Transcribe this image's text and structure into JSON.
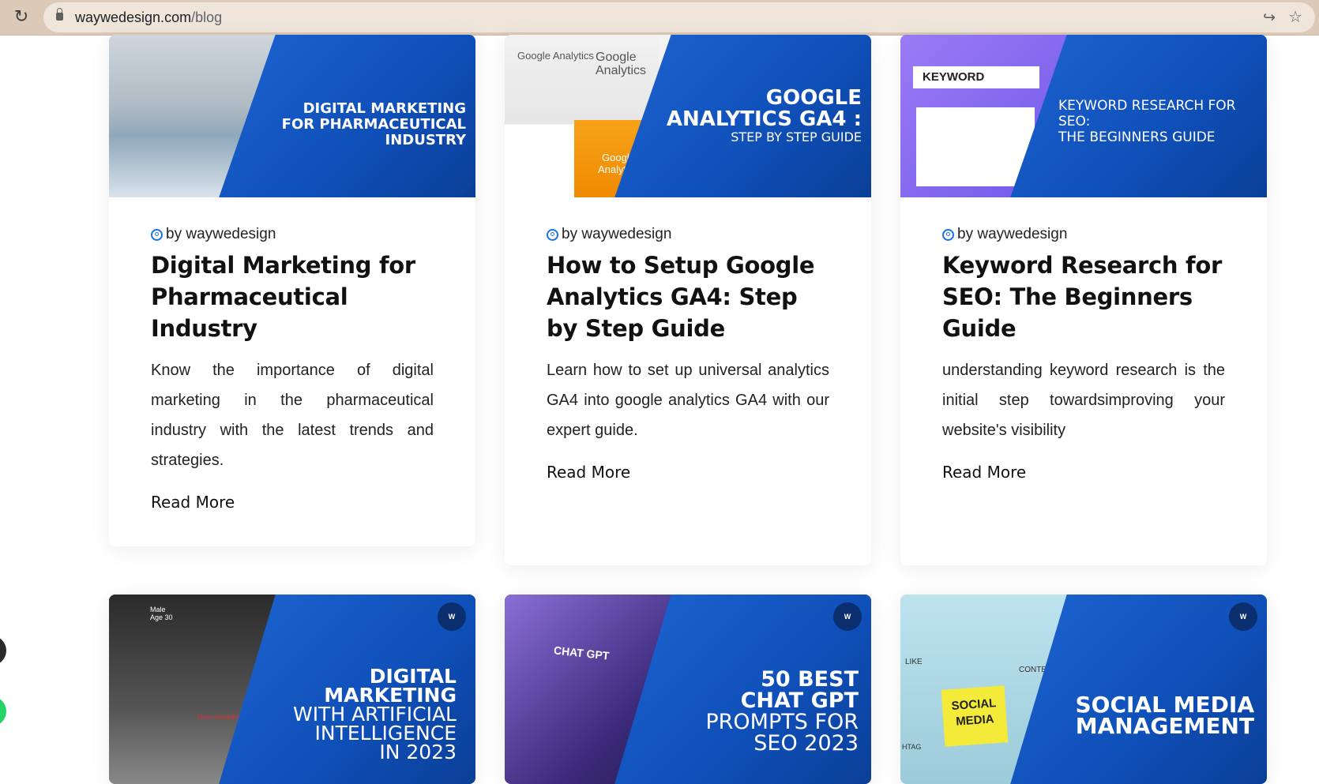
{
  "browser": {
    "url_host": "waywedesign.com",
    "url_path": "/blog"
  },
  "posts": [
    {
      "image_title": "DIGITAL MARKETING FOR PHARMACEUTICAL INDUSTRY",
      "image_lines": [
        "DIGITAL MARKETING",
        "FOR PHARMACEUTICAL",
        "INDUSTRY"
      ],
      "author": "by waywedesign",
      "title": "Digital Marketing for Pharmaceutical Industry",
      "excerpt": "Know the importance of digital marketing in the pharmaceutical industry with the latest trends and strategies.",
      "read_more": "Read More"
    },
    {
      "image_lines": [
        "GOOGLE",
        "ANALYTICS GA4 :",
        "STEP BY STEP GUIDE"
      ],
      "image_labels": [
        "Google Analytics",
        "Google Analytics",
        "Google Analytics"
      ],
      "author": "by waywedesign",
      "title": "How to Setup Google Analytics GA4: Step by Step Guide",
      "excerpt": "Learn how to set up universal analytics GA4 into google analytics GA4 with our expert guide.",
      "read_more": "Read More"
    },
    {
      "image_lines": [
        "KEYWORD RESEARCH FOR SEO:",
        "THE BEGINNERS GUIDE"
      ],
      "image_label": "KEYWORD",
      "author": "by waywedesign",
      "title": "Keyword Research for SEO: The Beginners Guide",
      "excerpt": "understanding keyword research is the initial step towardsimproving your website's visibility",
      "read_more": "Read More"
    }
  ],
  "next_row": [
    {
      "image_lines": [
        "DIGITAL",
        "MARKETING",
        "WITH ARTIFICIAL",
        "INTELLIGENCE",
        "IN 2023"
      ],
      "photo_labels": [
        "Male",
        "Age 30",
        "New Available"
      ]
    },
    {
      "image_lines": [
        "50 BEST",
        "CHAT GPT",
        "PROMPTS FOR",
        "SEO 2023"
      ],
      "photo_label": "CHAT GPT"
    },
    {
      "image_lines": [
        "SOCIAL MEDIA",
        "MANAGEMENT"
      ],
      "photo_labels": [
        "SOCIAL",
        "MEDIA",
        "LIKE",
        "CONTENT",
        "HTAG"
      ]
    }
  ],
  "colors": {
    "banner_blue": "#1559c4",
    "accent": "#1a73e8"
  }
}
